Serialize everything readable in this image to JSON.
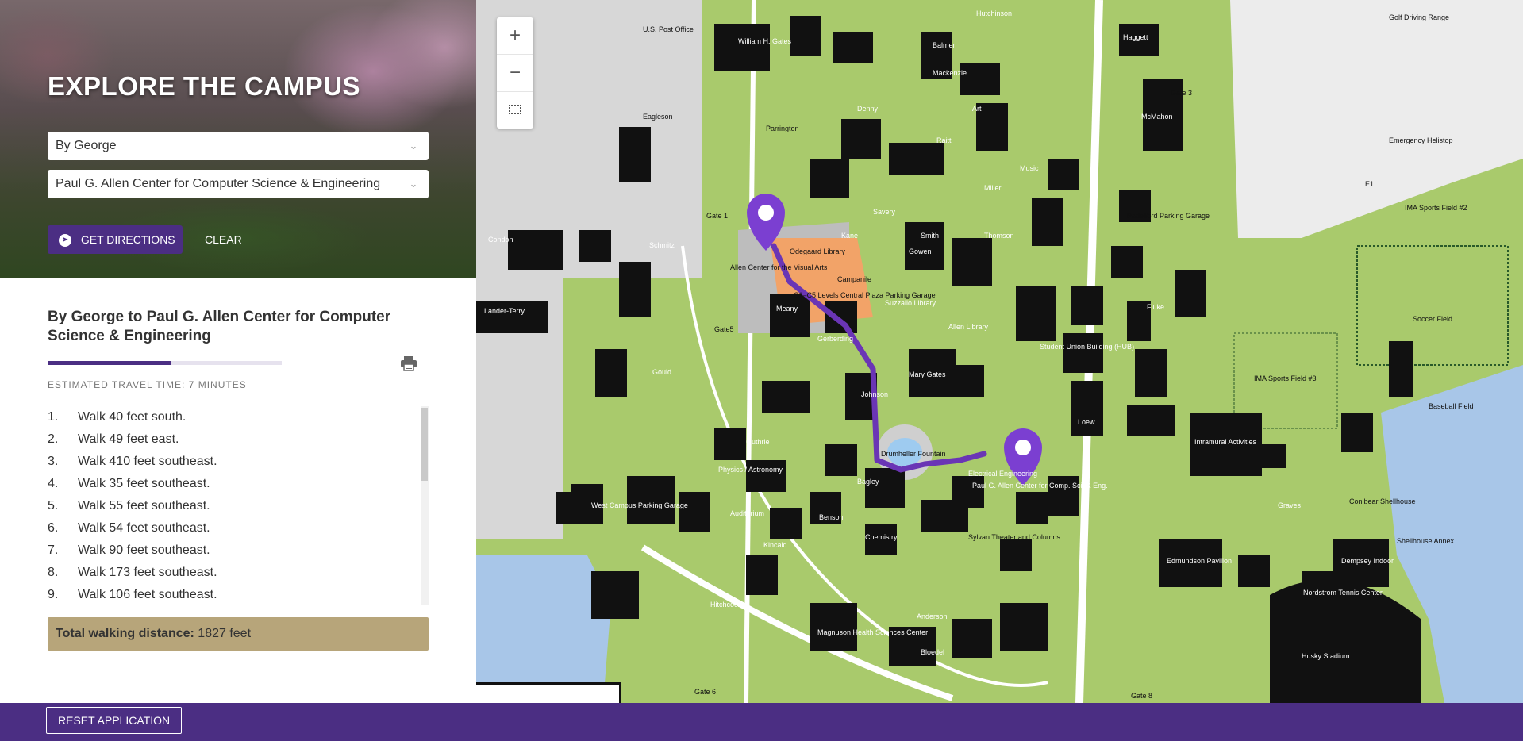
{
  "header": {
    "title": "EXPLORE THE CAMPUS"
  },
  "form": {
    "origin_value": "By George",
    "destination_value": "Paul G. Allen Center for Computer Science & Engineering",
    "directions_label": "GET DIRECTIONS",
    "clear_label": "CLEAR"
  },
  "route": {
    "heading": "By George to Paul G. Allen Center for Computer Science & Engineering",
    "travel_time": "ESTIMATED TRAVEL TIME: 7 MINUTES",
    "progress_fraction": 0.53,
    "steps": [
      {
        "num": "1.",
        "text": "Walk 40 feet south."
      },
      {
        "num": "2.",
        "text": "Walk 49 feet east."
      },
      {
        "num": "3.",
        "text": "Walk 410 feet southeast."
      },
      {
        "num": "4.",
        "text": "Walk 35 feet southeast."
      },
      {
        "num": "5.",
        "text": "Walk 55 feet southeast."
      },
      {
        "num": "6.",
        "text": "Walk 54 feet southeast."
      },
      {
        "num": "7.",
        "text": "Walk 90 feet southeast."
      },
      {
        "num": "8.",
        "text": "Walk 173 feet southeast."
      },
      {
        "num": "9.",
        "text": "Walk 106 feet southeast."
      }
    ],
    "total_label": "Total walking distance:",
    "total_value": "1827 feet"
  },
  "map": {
    "zoom_in": "+",
    "zoom_out": "−",
    "labels": {
      "gates": "William H. Gates",
      "allen_visual": "Allen Center for the Visual Arts",
      "meany": "Meany",
      "suzzallo": "Suzzallo Library",
      "allen_library": "Allen Library",
      "kane": "Kane",
      "garage": "C1–C5 Levels Central Plaza Parking Garage",
      "drumheller": "Drumheller Fountain",
      "allen_center": "Paul G. Allen Center for Comp. Sci. & Eng.",
      "electrical": "Electrical Engineering",
      "hub": "Student Union Building (HUB)",
      "mcmahon": "McMahon",
      "haggett": "Haggett",
      "ima_field": "IMA Sports Field #2",
      "ima_field3": "IMA Sports Field #3",
      "soccer": "Soccer Field",
      "baseball": "Baseball Field",
      "intramural": "Intramural Activities",
      "edmundson": "Edmundson Pavilion",
      "nordstrom": "Nordstrom Tennis Center",
      "dempsey": "Dempsey Indoor",
      "husky": "Husky Stadium",
      "padelford": "Padelford Parking Garage",
      "golf": "Golf Driving Range",
      "emergency": "Emergency Helistop",
      "shellhouse": "Shellhouse Annex",
      "conibear": "Conibear Shellhouse",
      "magnuson": "Magnuson Health Sciences Center",
      "bagley": "Bagley",
      "chemistry": "Chemistry",
      "mary_gates": "Mary Gates",
      "guthrie": "Guthrie",
      "gould": "Gould",
      "schmitz": "Schmitz",
      "lander": "Lander-Terry",
      "condon": "Condon",
      "west_garage": "West Campus Parking Garage",
      "e1": "E1",
      "gate_1": "Gate 1",
      "gate_3": "Gate 3",
      "gate_5": "Gate5",
      "gate_6": "Gate 6",
      "gate_8": "Gate 8",
      "post_office": "U.S. Post Office",
      "eagleson": "Eagleson",
      "kincaid": "Kincaid",
      "benson": "Benson",
      "sylvan": "Sylvan Theater and Columns",
      "anderson": "Anderson",
      "bloedel": "Bloedel",
      "loew": "Loew",
      "fluke": "Fluke",
      "savery": "Savery",
      "smith": "Smith",
      "miller": "Miller",
      "denny": "Denny",
      "red_square": "Campanile",
      "parrington": "Parrington",
      "music": "Music",
      "art": "Art",
      "raitt": "Raitt",
      "thomson": "Thomson",
      "gowen": "Gowen",
      "mackenzie": "Mackenzie",
      "balmer": "Balmer",
      "hutchinson": "Hutchinson",
      "odegaard": "Odegaard Library",
      "physics": "Physics / Astronomy",
      "auditorium": "Auditorium",
      "hitchcock": "Hitchcock",
      "graves": "Graves",
      "johnson": "Johnson",
      "gerberding": "Gerberding"
    }
  }
}
